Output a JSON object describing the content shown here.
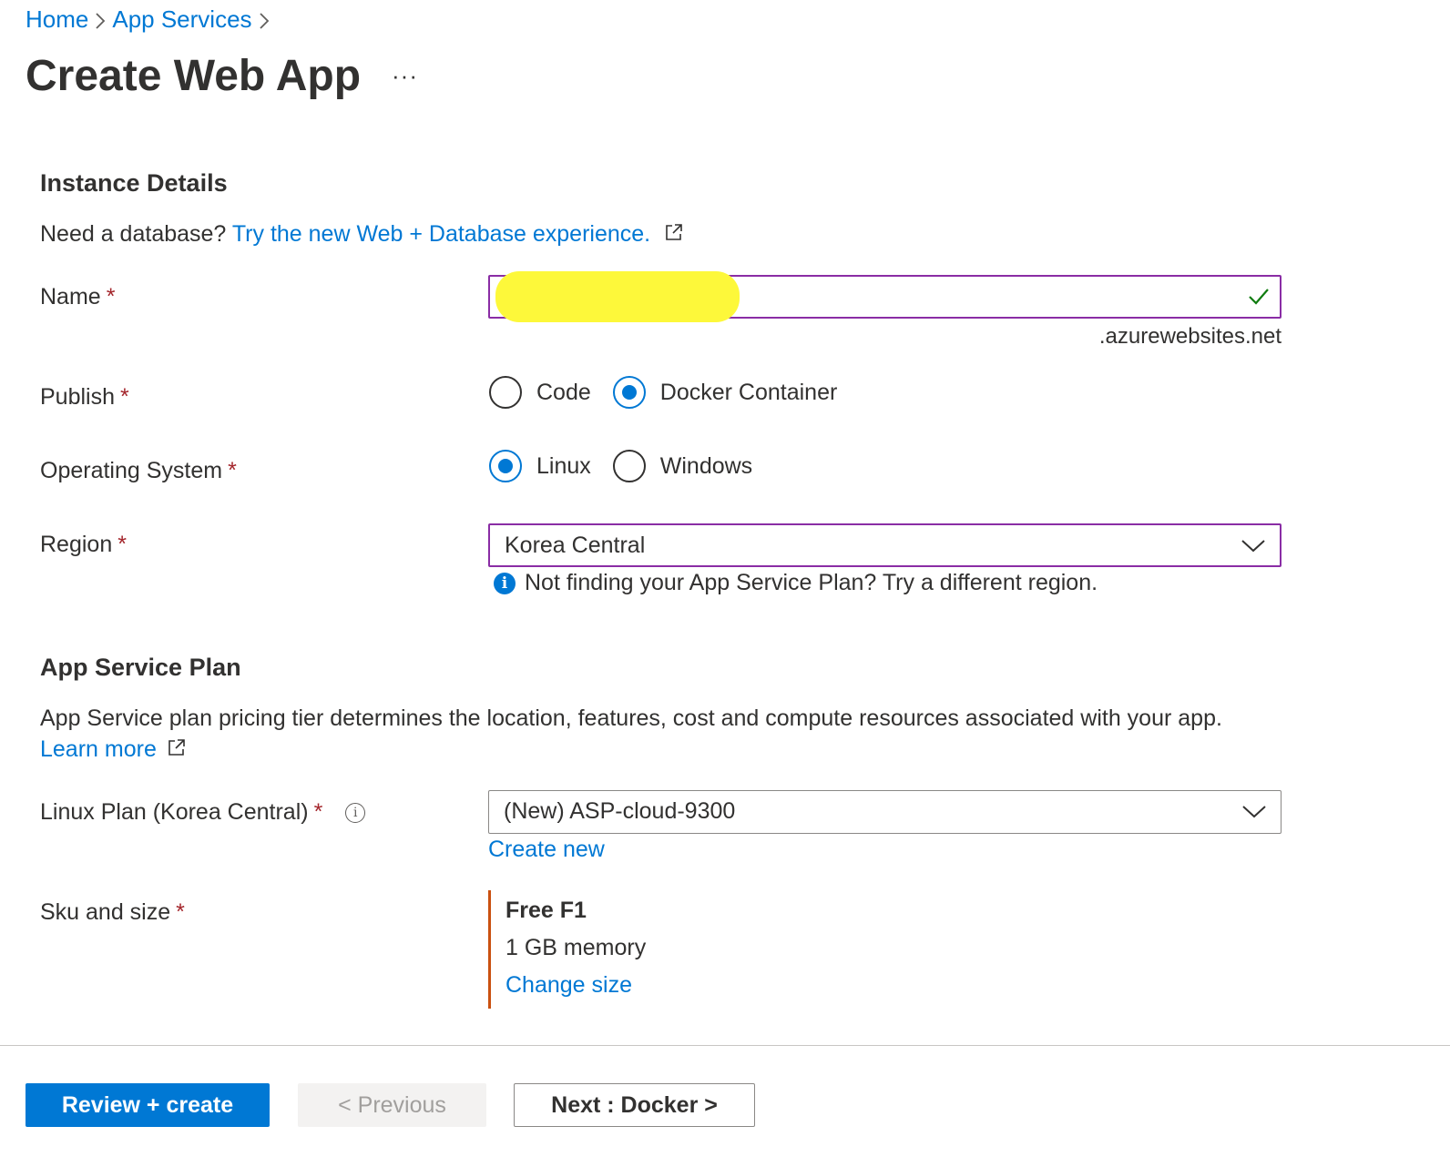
{
  "breadcrumb": {
    "items": [
      "Home",
      "App Services"
    ]
  },
  "page": {
    "title": "Create Web App",
    "more": "···"
  },
  "instance": {
    "title": "Instance Details",
    "db_prompt": "Need a database?",
    "db_link": "Try the new Web + Database experience.",
    "name_label": "Name",
    "name_value": "",
    "name_suffix": ".azurewebsites.net",
    "publish_label": "Publish",
    "publish_options": [
      "Code",
      "Docker Container"
    ],
    "publish_selected": "Docker Container",
    "os_label": "Operating System",
    "os_options": [
      "Linux",
      "Windows"
    ],
    "os_selected": "Linux",
    "region_label": "Region",
    "region_value": "Korea Central",
    "region_info": "Not finding your App Service Plan? Try a different region."
  },
  "plan": {
    "title": "App Service Plan",
    "description": "App Service plan pricing tier determines the location, features, cost and compute resources associated with your app.",
    "learn_more": "Learn more",
    "plan_label": "Linux Plan (Korea Central)",
    "plan_value": "(New) ASP-cloud-9300",
    "create_new": "Create new",
    "sku_label": "Sku and size",
    "sku_title": "Free F1",
    "sku_memory": "1 GB memory",
    "change_size": "Change size"
  },
  "required_marker": "*",
  "footer": {
    "review_create": "Review + create",
    "previous": "< Previous",
    "next": "Next : Docker >"
  },
  "colors": {
    "accent": "#0078d4",
    "focus_border": "#8a2da5",
    "required": "#a4262c",
    "sku_bar": "#ca5010",
    "valid": "#107c10"
  }
}
